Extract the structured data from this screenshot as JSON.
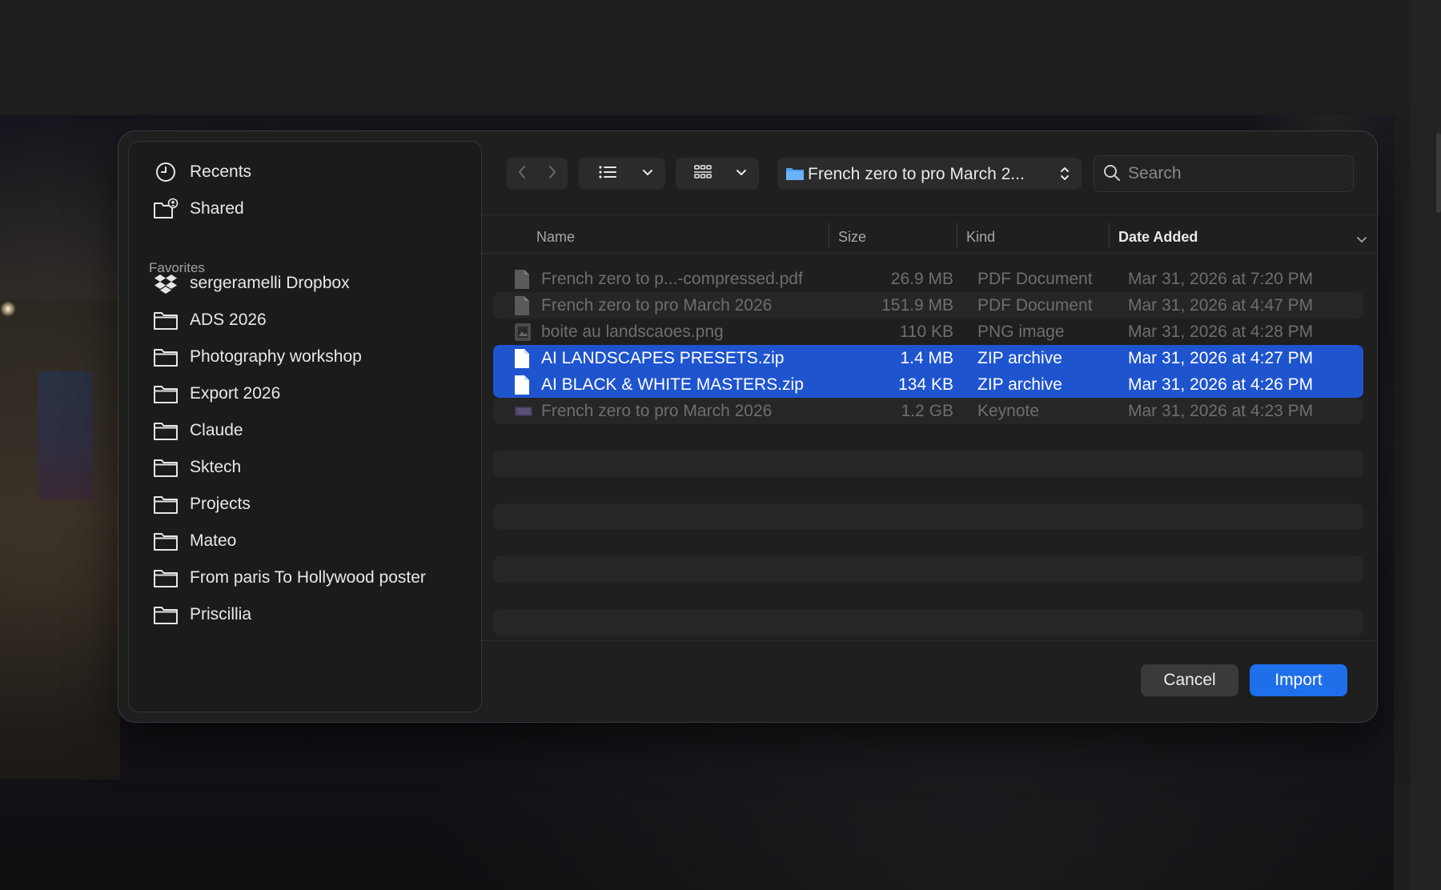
{
  "sidebar": {
    "top_items": [
      {
        "label": "Recents",
        "icon": "clock-icon"
      },
      {
        "label": "Shared",
        "icon": "shared-folder-icon"
      }
    ],
    "favorites_heading": "Favorites",
    "favorites": [
      {
        "label": "sergeramelli Dropbox",
        "icon": "dropbox-icon"
      },
      {
        "label": "ADS 2026",
        "icon": "folder-icon"
      },
      {
        "label": "Photography workshop",
        "icon": "folder-icon"
      },
      {
        "label": "Export 2026",
        "icon": "folder-icon"
      },
      {
        "label": "Claude",
        "icon": "folder-icon"
      },
      {
        "label": "Sktech",
        "icon": "folder-icon"
      },
      {
        "label": "Projects",
        "icon": "folder-icon"
      },
      {
        "label": "Mateo",
        "icon": "folder-icon"
      },
      {
        "label": "From paris To Hollywood poster",
        "icon": "folder-icon"
      },
      {
        "label": "Priscillia",
        "icon": "folder-icon"
      }
    ]
  },
  "toolbar": {
    "location": "French zero to pro March 2...",
    "search_placeholder": "Search"
  },
  "columns": {
    "name": "Name",
    "size": "Size",
    "kind": "Kind",
    "date": "Date Added"
  },
  "files": [
    {
      "name": "French zero to p...-compressed.pdf",
      "size": "26.9 MB",
      "kind": "PDF Document",
      "date": "Mar 31, 2026 at 7:20 PM",
      "icon": "pdf-file-icon"
    },
    {
      "name": "French zero to pro March 2026",
      "size": "151.9 MB",
      "kind": "PDF Document",
      "date": "Mar 31, 2026 at 4:47 PM",
      "icon": "pdf-file-icon"
    },
    {
      "name": "boite au landscaoes.png",
      "size": "110 KB",
      "kind": "PNG image",
      "date": "Mar 31, 2026 at 4:28 PM",
      "icon": "image-file-icon"
    },
    {
      "name": "AI LANDSCAPES PRESETS.zip",
      "size": "1.4 MB",
      "kind": "ZIP archive",
      "date": "Mar 31, 2026 at 4:27 PM",
      "icon": "zip-file-icon"
    },
    {
      "name": "AI BLACK & WHITE MASTERS.zip",
      "size": "134 KB",
      "kind": "ZIP archive",
      "date": "Mar 31, 2026 at 4:26 PM",
      "icon": "zip-file-icon"
    },
    {
      "name": "French zero to pro March 2026",
      "size": "1.2 GB",
      "kind": "Keynote",
      "date": "Mar 31, 2026 at 4:23 PM",
      "icon": "keynote-file-icon"
    }
  ],
  "buttons": {
    "cancel": "Cancel",
    "import": "Import"
  },
  "colors": {
    "accent": "#1f6feb",
    "selection": "#1f54cf"
  }
}
